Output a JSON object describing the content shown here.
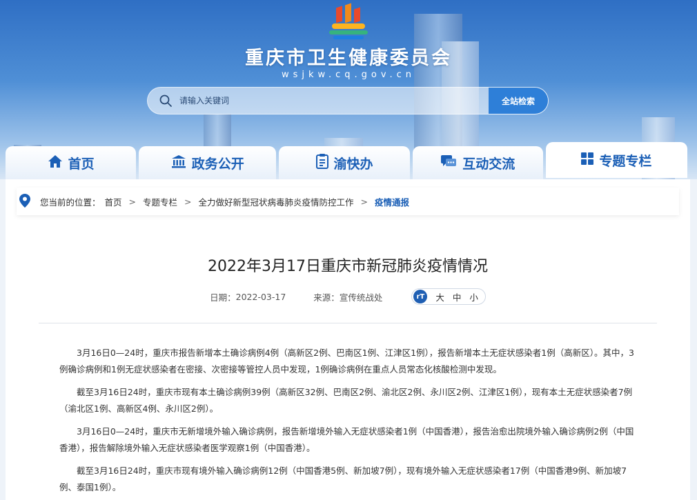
{
  "header": {
    "site_title": "重庆市卫生健康委员会",
    "site_domain": "wsjkw.cq.gov.cn"
  },
  "search": {
    "placeholder": "请输入关键词",
    "button_label": "全站检索"
  },
  "nav": {
    "items": [
      {
        "label": "首页",
        "icon": "home-icon"
      },
      {
        "label": "政务公开",
        "icon": "government-icon"
      },
      {
        "label": "渝快办",
        "icon": "service-icon"
      },
      {
        "label": "互动交流",
        "icon": "chat-icon"
      },
      {
        "label": "专题专栏",
        "icon": "grid-icon"
      }
    ]
  },
  "breadcrumb": {
    "prefix": "您当前的位置：",
    "items": [
      "首页",
      "专题专栏",
      "全力做好新型冠状病毒肺炎疫情防控工作",
      "疫情通报"
    ],
    "separator": ">"
  },
  "article": {
    "title": "2022年3月17日重庆市新冠肺炎疫情情况",
    "date_label": "日期：",
    "date": "2022-03-17",
    "source_label": "来源：",
    "source": "宣传统战处",
    "font_sizes": [
      "大",
      "中",
      "小"
    ],
    "font_icon_text": "rT",
    "paragraphs": [
      "3月16日0—24时，重庆市报告新增本土确诊病例4例（高新区2例、巴南区1例、江津区1例），报告新增本土无症状感染者1例（高新区）。其中，3例确诊病例和1例无症状感染者在密接、次密接等管控人员中发现，1例确诊病例在重点人员常态化核酸检测中发现。",
      "截至3月16日24时，重庆市现有本土确诊病例39例（高新区32例、巴南区2例、渝北区2例、永川区2例、江津区1例），现有本土无症状感染者7例（渝北区1例、高新区4例、永川区2例）。",
      "3月16日0—24时，重庆市无新增境外输入确诊病例，报告新增境外输入无症状感染者1例（中国香港），报告治愈出院境外输入确诊病例2例（中国香港），报告解除境外输入无症状感染者医学观察1例（中国香港）。",
      "截至3月16日24时，重庆市现有境外输入确诊病例12例（中国香港5例、新加坡7例），现有境外输入无症状感染者17例（中国香港9例、新加坡7例、泰国1例）。"
    ]
  },
  "colors": {
    "brand_blue": "#1b5fb6",
    "search_button": "#2e7fd8"
  }
}
